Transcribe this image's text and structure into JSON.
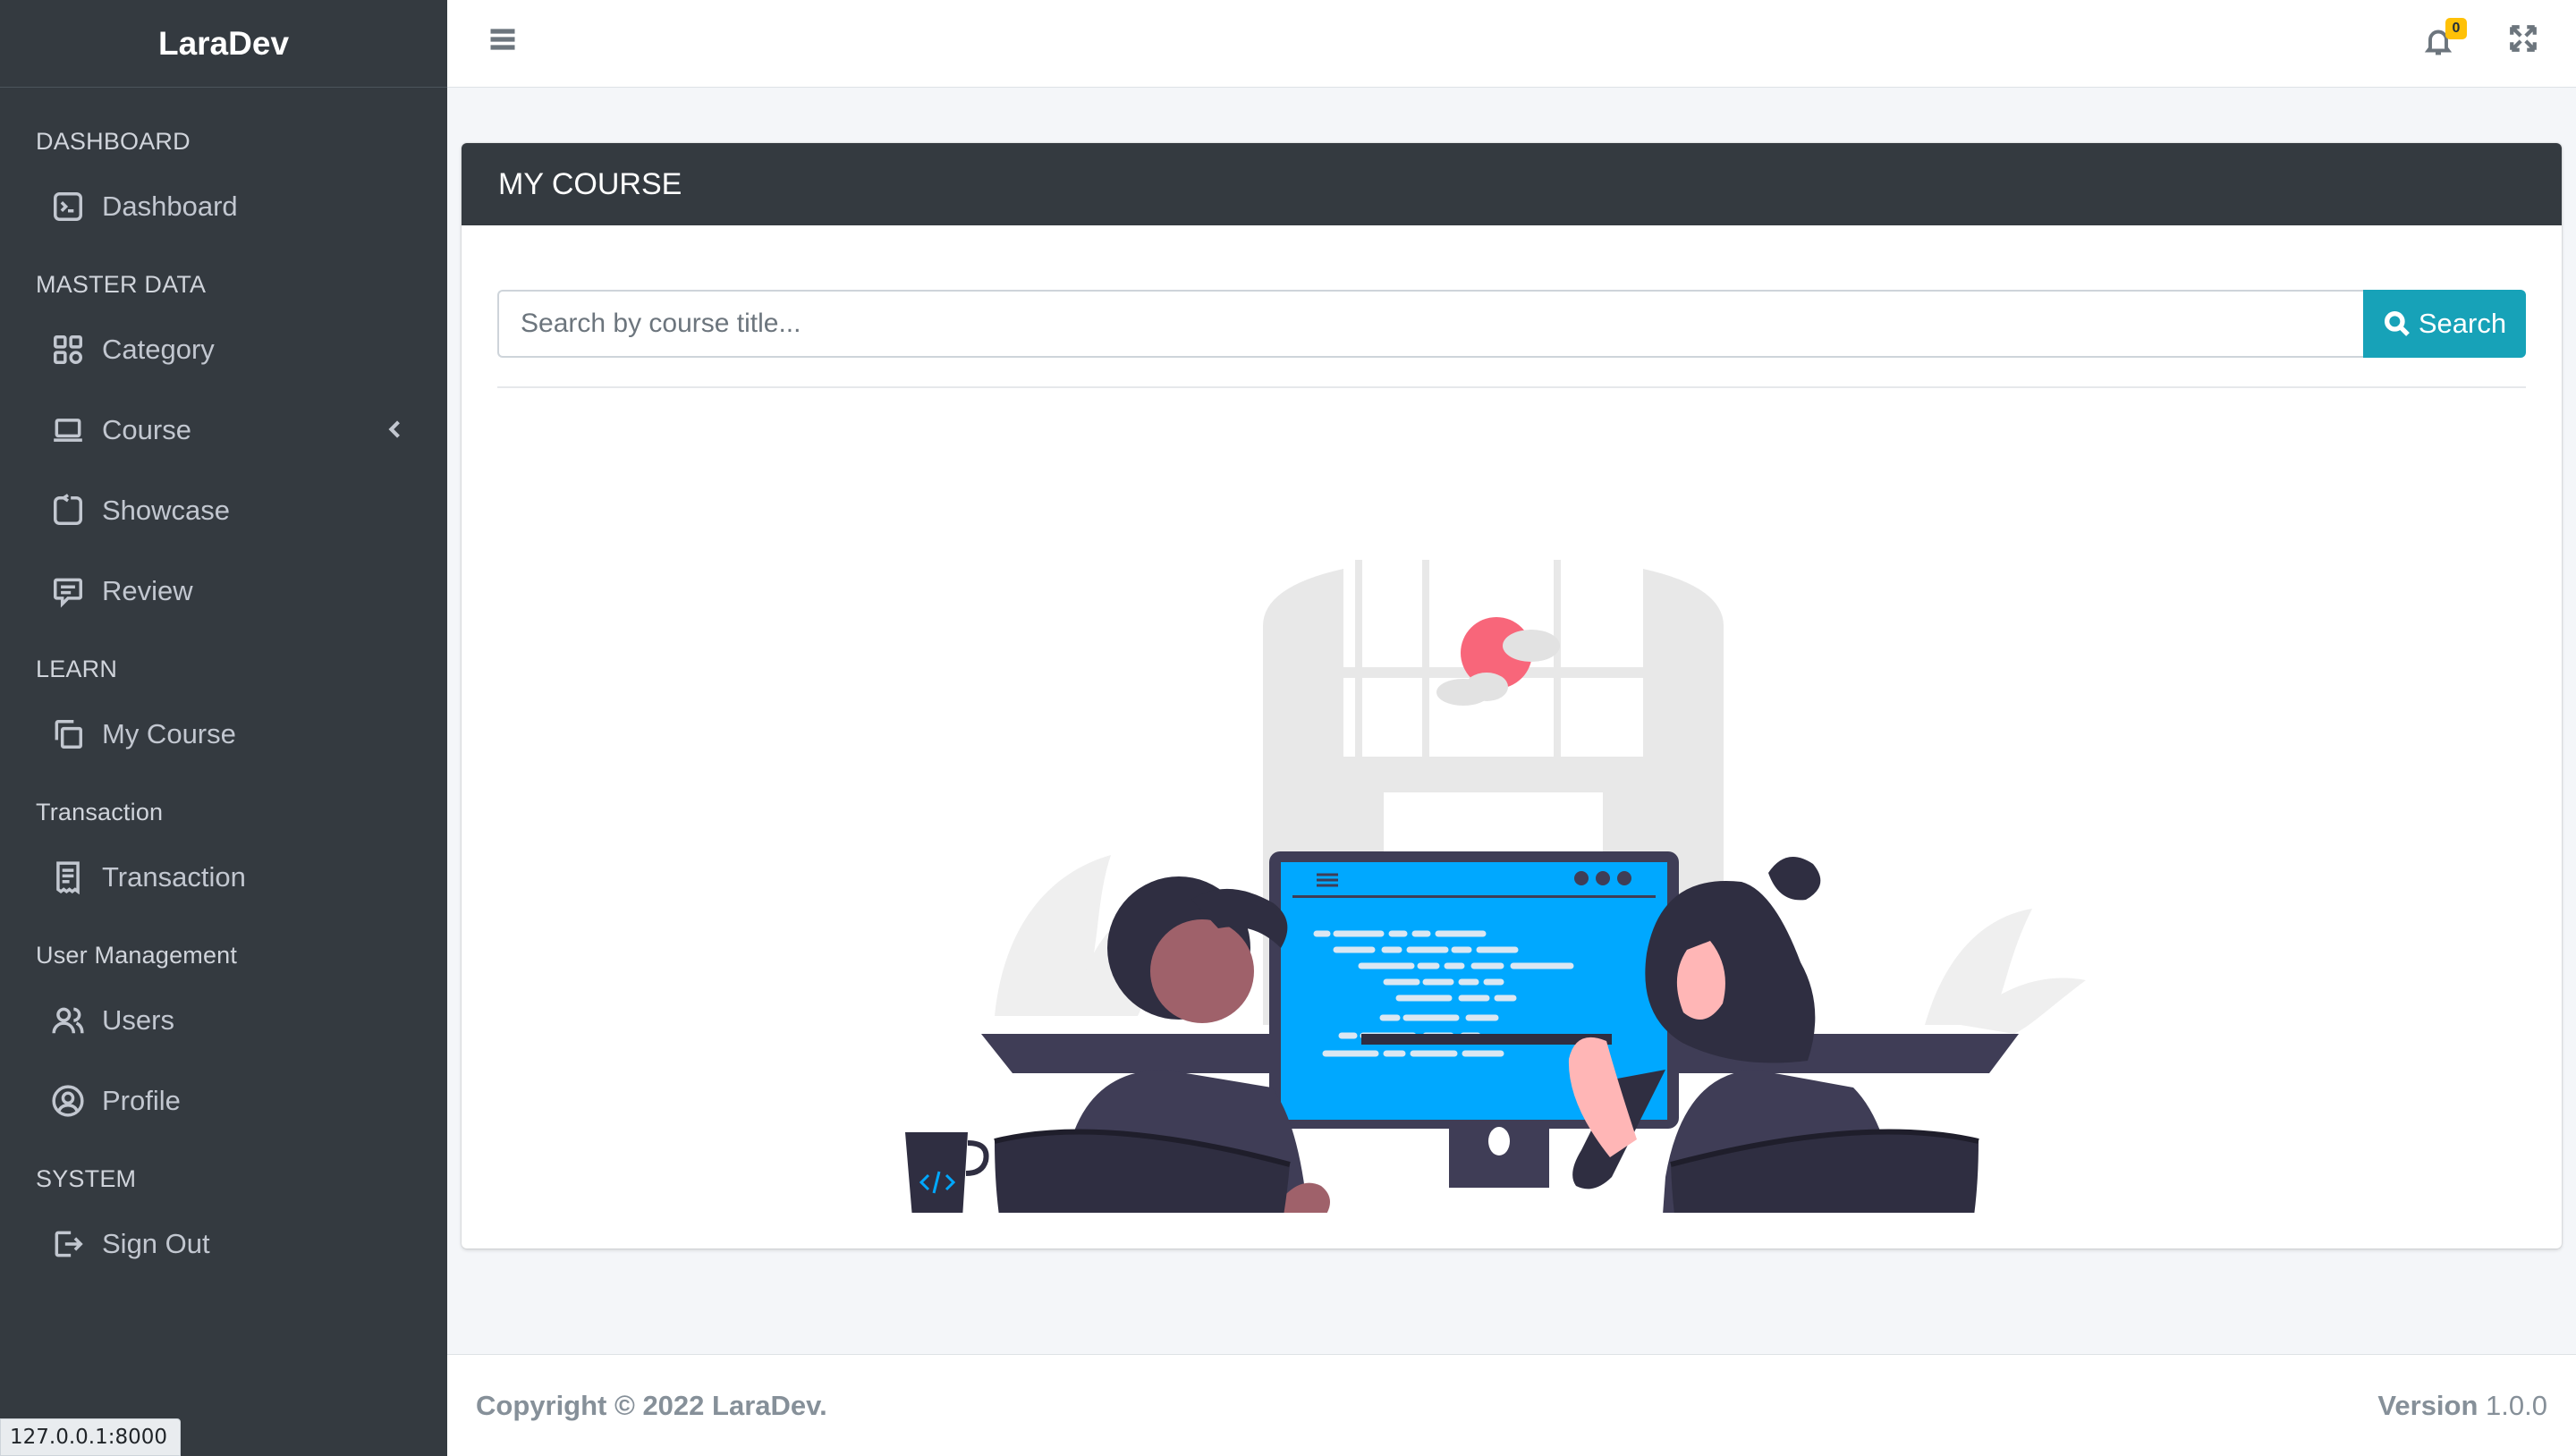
{
  "brand": "LaraDev",
  "sidebar": {
    "sections": [
      {
        "header": "DASHBOARD",
        "items": [
          {
            "label": "Dashboard",
            "icon": "terminal-square-icon"
          }
        ]
      },
      {
        "header": "MASTER DATA",
        "items": [
          {
            "label": "Category",
            "icon": "grid-icon"
          },
          {
            "label": "Course",
            "icon": "laptop-icon",
            "has_submenu": true
          },
          {
            "label": "Showcase",
            "icon": "rotate-square-icon"
          },
          {
            "label": "Review",
            "icon": "chat-square-icon"
          }
        ]
      },
      {
        "header": "LEARN",
        "items": [
          {
            "label": "My Course",
            "icon": "copy-icon"
          }
        ]
      },
      {
        "header": "Transaction",
        "items": [
          {
            "label": "Transaction",
            "icon": "receipt-icon"
          }
        ]
      },
      {
        "header": "User Management",
        "items": [
          {
            "label": "Users",
            "icon": "people-icon"
          },
          {
            "label": "Profile",
            "icon": "person-circle-icon"
          }
        ]
      },
      {
        "header": "SYSTEM",
        "items": [
          {
            "label": "Sign Out",
            "icon": "sign-out-icon"
          }
        ]
      }
    ]
  },
  "topbar": {
    "notification_count": "0"
  },
  "card": {
    "title": "MY COURSE",
    "search": {
      "placeholder": "Search by course title...",
      "value": "",
      "button_label": "Search"
    }
  },
  "footer": {
    "copyright": "Copyright © 2022 LaraDev.",
    "version_label": "Version",
    "version_value": "1.0.0"
  },
  "status_url": "127.0.0.1:8000",
  "colors": {
    "sidebar_bg": "#343a40",
    "accent": "#17a2b8",
    "badge": "#ffc107",
    "screen_blue": "#00a8ff",
    "sun_pink": "#f8667a"
  }
}
